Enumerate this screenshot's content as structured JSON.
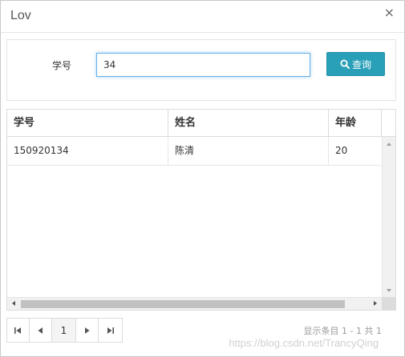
{
  "dialog": {
    "title": "Lov",
    "close_glyph": "×"
  },
  "search": {
    "label": "学号",
    "value": "34",
    "button_label": "查询"
  },
  "grid": {
    "columns": [
      "学号",
      "姓名",
      "年龄"
    ],
    "rows": [
      {
        "id": "150920134",
        "name": "陈清",
        "age": "20"
      }
    ]
  },
  "pager": {
    "current_page": "1",
    "status_text": "显示条目 1 - 1 共 1"
  },
  "watermark": "https://blog.csdn.net/TrancyQing",
  "colors": {
    "search_button": "#2aa0b8",
    "input_focus_border": "#66afe9"
  }
}
